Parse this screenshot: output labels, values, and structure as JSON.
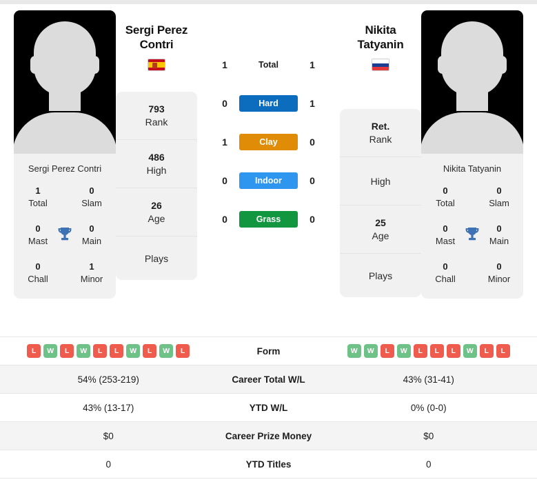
{
  "players": {
    "left": {
      "name": "Sergi Perez Contri",
      "display_name_line1": "Sergi Perez",
      "display_name_line2": "Contri",
      "country_flag": "flag-spain-icon",
      "photo": "player-silhouette-photo",
      "titles": {
        "total_value": "1",
        "total_label": "Total",
        "slam_value": "0",
        "slam_label": "Slam",
        "mast_value": "0",
        "mast_label": "Mast",
        "main_value": "0",
        "main_label": "Main",
        "chall_value": "0",
        "chall_label": "Chall",
        "minor_value": "1",
        "minor_label": "Minor"
      },
      "info": [
        {
          "value": "793",
          "label": "Rank"
        },
        {
          "value": "486",
          "label": "High"
        },
        {
          "value": "26",
          "label": "Age"
        },
        {
          "value": "",
          "label": "Plays"
        }
      ],
      "form": [
        "L",
        "W",
        "L",
        "W",
        "L",
        "L",
        "W",
        "L",
        "W",
        "L"
      ]
    },
    "right": {
      "name": "Nikita Tatyanin",
      "display_name_line1": "Nikita",
      "display_name_line2": "Tatyanin",
      "country_flag": "flag-russia-icon",
      "photo": "player-silhouette-photo",
      "titles": {
        "total_value": "0",
        "total_label": "Total",
        "slam_value": "0",
        "slam_label": "Slam",
        "mast_value": "0",
        "mast_label": "Mast",
        "main_value": "0",
        "main_label": "Main",
        "chall_value": "0",
        "chall_label": "Chall",
        "minor_value": "0",
        "minor_label": "Minor"
      },
      "info": [
        {
          "value": "Ret.",
          "label": "Rank"
        },
        {
          "value": "",
          "label": "High"
        },
        {
          "value": "25",
          "label": "Age"
        },
        {
          "value": "",
          "label": "Plays"
        }
      ],
      "form": [
        "W",
        "W",
        "L",
        "W",
        "L",
        "L",
        "L",
        "W",
        "L",
        "L"
      ]
    }
  },
  "surfaces": [
    {
      "key": "total",
      "label": "Total",
      "left": "1",
      "right": "1",
      "color": ""
    },
    {
      "key": "hard",
      "label": "Hard",
      "left": "0",
      "right": "1",
      "color": "#0c6cbe"
    },
    {
      "key": "clay",
      "label": "Clay",
      "left": "1",
      "right": "0",
      "color": "#e08c06"
    },
    {
      "key": "indoor",
      "label": "Indoor",
      "left": "0",
      "right": "0",
      "color": "#2f96f0"
    },
    {
      "key": "grass",
      "label": "Grass",
      "left": "0",
      "right": "0",
      "color": "#12963f"
    }
  ],
  "stats_table": {
    "form_label": "Form",
    "rows": [
      {
        "label": "Career Total W/L",
        "left": "54% (253-219)",
        "right": "43% (31-41)"
      },
      {
        "label": "YTD W/L",
        "left": "43% (13-17)",
        "right": "0% (0-0)"
      },
      {
        "label": "Career Prize Money",
        "left": "$0",
        "right": "$0"
      },
      {
        "label": "YTD Titles",
        "left": "0",
        "right": "0"
      }
    ]
  },
  "colors": {
    "win": "#6ec287",
    "loss": "#ef5b4c",
    "card_bg": "#f1f1f2",
    "row_shade": "#f4f4f5"
  }
}
